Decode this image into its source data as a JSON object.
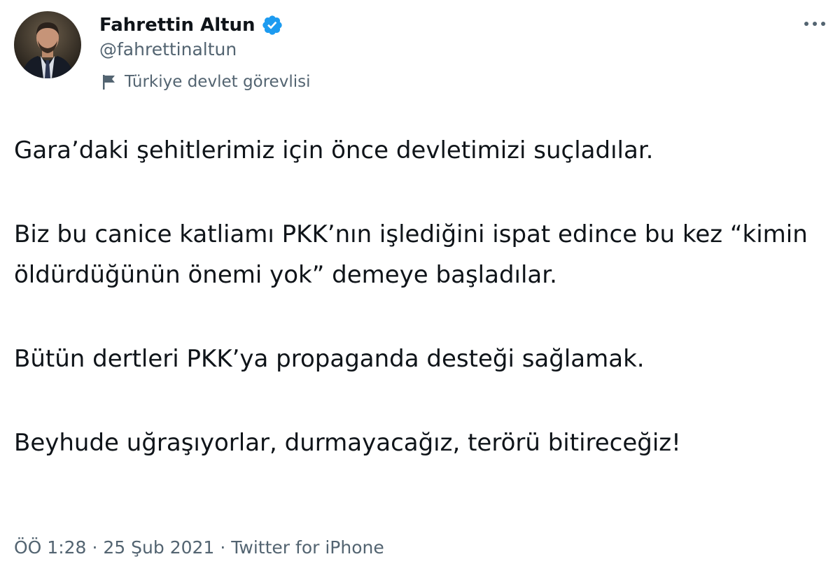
{
  "user": {
    "display_name": "Fahrettin Altun",
    "handle": "@fahrettinaltun",
    "verified": true,
    "label": "Türkiye devlet görevlisi",
    "avatar_icon": "profile-photo",
    "verified_icon": "verified-badge-icon",
    "label_icon": "flag-icon"
  },
  "menu": {
    "more_icon": "more-options-icon"
  },
  "tweet": {
    "paragraphs": [
      "Gara’daki şehitlerimiz için önce devletimizi suçladılar.",
      "Biz bu canice katliamı PKK’nın işlediğini ispat edince bu kez “kimin öldürdüğünün önemi yok” demeye başladılar.",
      "Bütün dertleri PKK’ya propaganda desteği sağlamak.",
      "Beyhude uğraşıyorlar, durmayacağız, terörü bitireceğiz!"
    ]
  },
  "meta": {
    "time": "ÖÖ 1:28",
    "separator": "·",
    "date": "25 Şub 2021",
    "source": "Twitter for iPhone"
  },
  "colors": {
    "text_primary": "#0f1419",
    "text_secondary": "#536471",
    "verified_blue": "#1d9bf0",
    "background": "#ffffff"
  }
}
